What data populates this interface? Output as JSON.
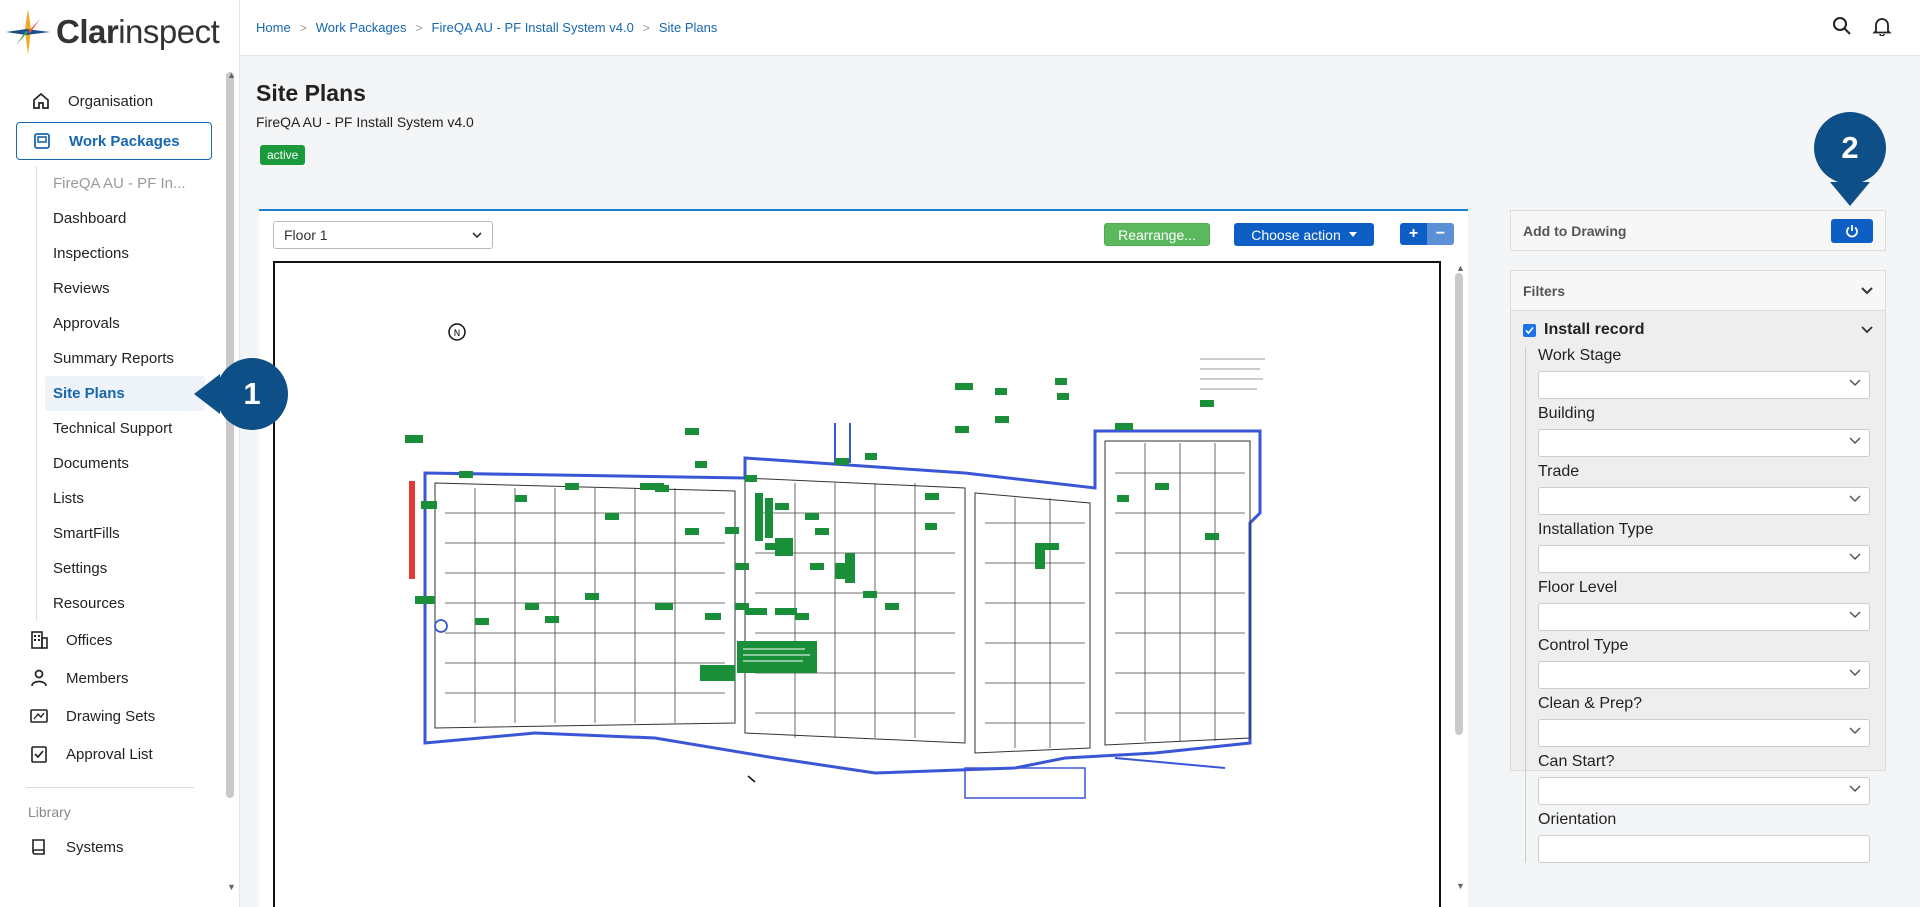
{
  "app": {
    "logo_prefix": "Clar",
    "logo_suffix": "inspect"
  },
  "breadcrumb": [
    "Home",
    "Work Packages",
    "FireQA AU - PF Install System v4.0",
    "Site Plans"
  ],
  "sidebar": {
    "top_items": [
      {
        "label": "Organisation",
        "icon": "home-icon"
      },
      {
        "label": "Work Packages",
        "icon": "package-icon"
      }
    ],
    "sub_items": [
      {
        "label": "FireQA AU - PF In..."
      },
      {
        "label": "Dashboard"
      },
      {
        "label": "Inspections"
      },
      {
        "label": "Reviews"
      },
      {
        "label": "Approvals"
      },
      {
        "label": "Summary Reports"
      },
      {
        "label": "Site Plans"
      },
      {
        "label": "Technical Support"
      },
      {
        "label": "Documents"
      },
      {
        "label": "Lists"
      },
      {
        "label": "SmartFills"
      },
      {
        "label": "Settings"
      },
      {
        "label": "Resources"
      }
    ],
    "bottom_items": [
      {
        "label": "Offices",
        "icon": "building-icon"
      },
      {
        "label": "Members",
        "icon": "person-icon"
      },
      {
        "label": "Drawing Sets",
        "icon": "drawing-icon"
      },
      {
        "label": "Approval List",
        "icon": "checklist-icon"
      }
    ],
    "library_title": "Library",
    "library_items": [
      {
        "label": "Systems",
        "icon": "book-icon"
      }
    ]
  },
  "page": {
    "title": "Site Plans",
    "subtitle": "FireQA AU - PF Install System v4.0",
    "status": "active"
  },
  "toolbar": {
    "floor": "Floor 1",
    "rearrange": "Rearrange...",
    "choose_action": "Choose action",
    "zoom_in": "+",
    "zoom_out": "−"
  },
  "right_panel": {
    "add_to_drawing": "Add to Drawing",
    "filters": "Filters",
    "install_record": "Install record",
    "fields": [
      "Work Stage",
      "Building",
      "Trade",
      "Installation Type",
      "Floor Level",
      "Control Type",
      "Clean & Prep?",
      "Can Start?",
      "Orientation"
    ]
  },
  "callouts": {
    "one": "1",
    "two": "2"
  },
  "colors": {
    "accent": "#1667b0",
    "callout": "#0d4f86",
    "active_badge": "#1a9a3b",
    "primary_button": "#0d5fc6",
    "rearrange_button": "#5cb85c"
  }
}
